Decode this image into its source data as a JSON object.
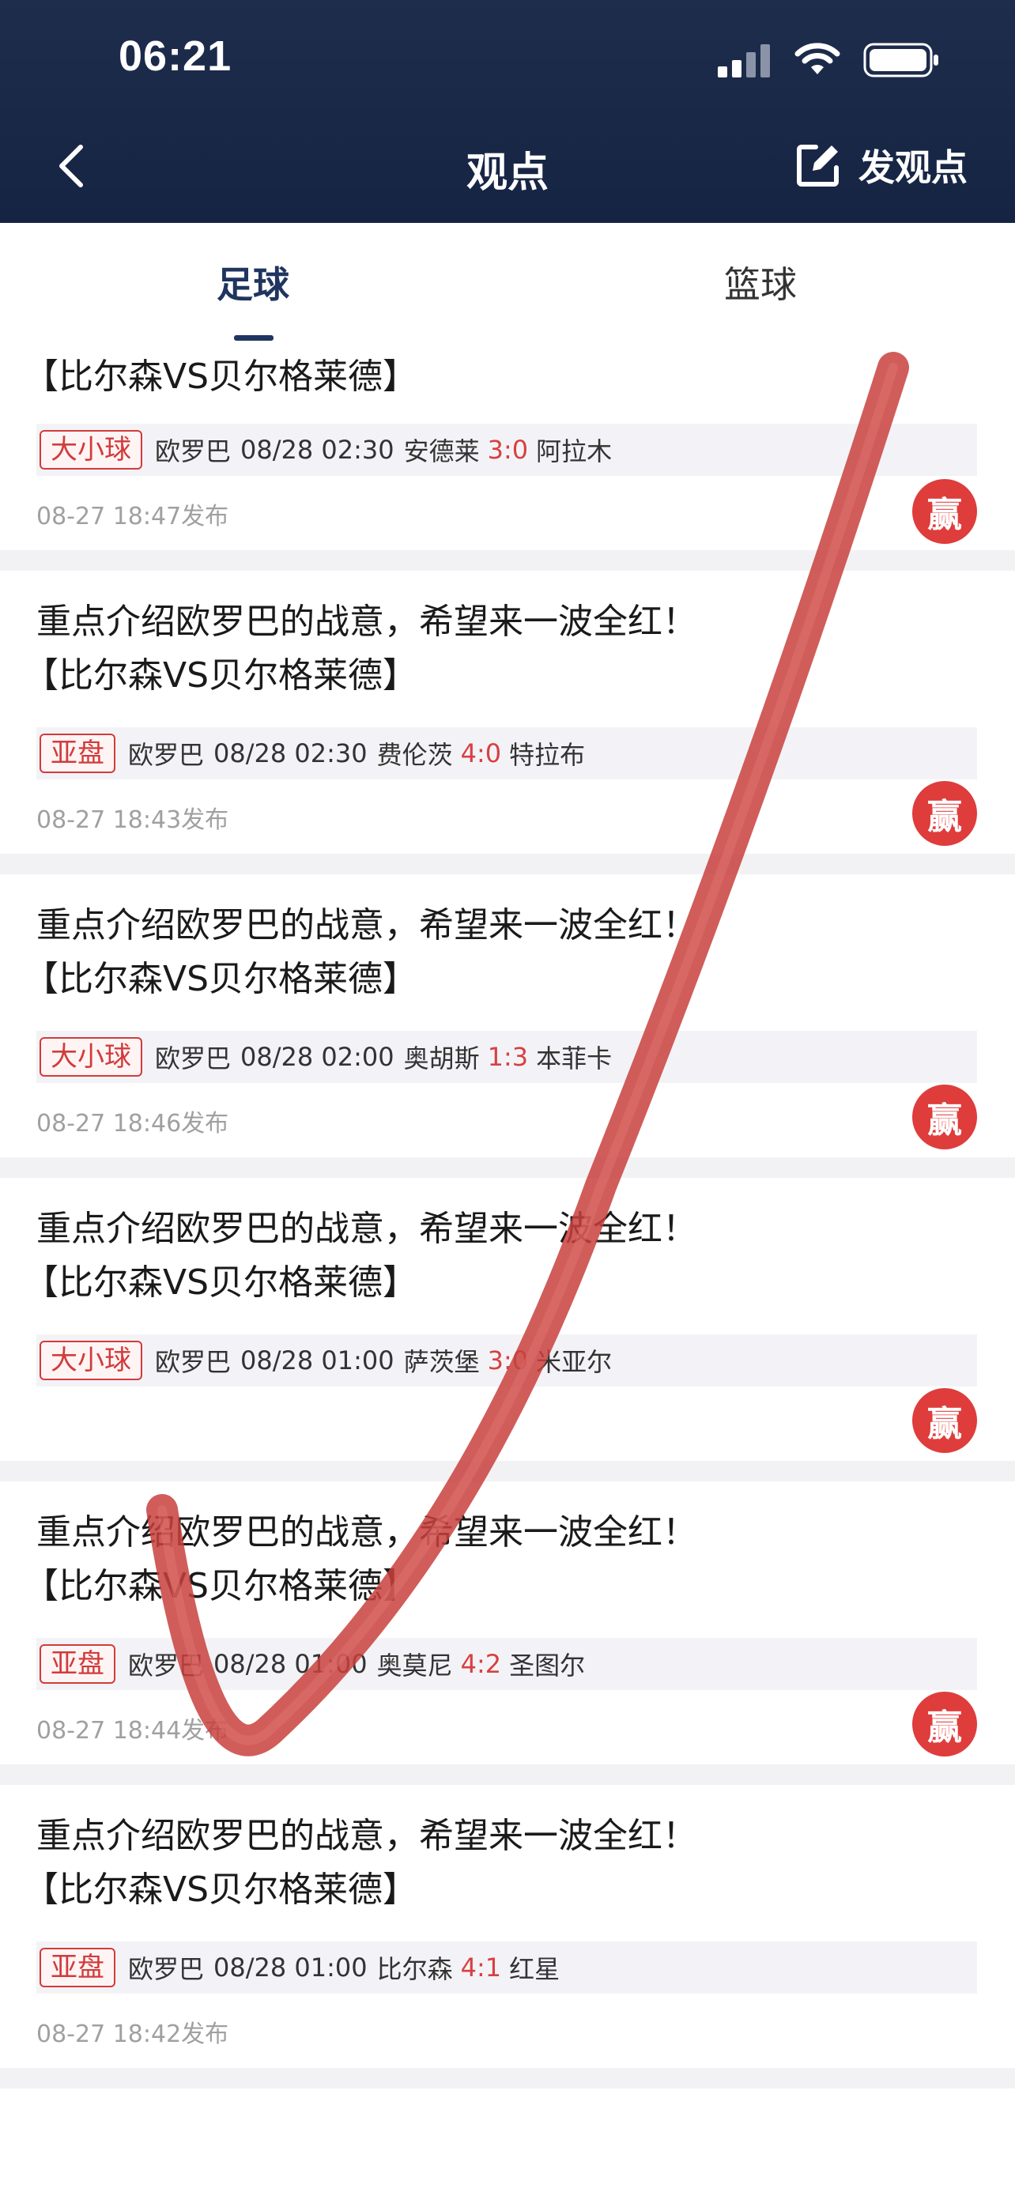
{
  "status": {
    "time": "06:21"
  },
  "header": {
    "title": "观点",
    "publish_label": "发观点"
  },
  "tabs": [
    {
      "label": "足球"
    },
    {
      "label": "篮球"
    }
  ],
  "posts": [
    {
      "title1": "",
      "title2": "【比尔森VS贝尔格莱德】",
      "tag": "大小球",
      "league": "欧罗巴",
      "datetime": "08/28 02:30",
      "home": "安德莱",
      "score": "3:0",
      "away": "阿拉木",
      "posted": "08-27 18:47发布",
      "result": "赢"
    },
    {
      "title1": "重点介绍欧罗巴的战意，希望来一波全红！",
      "title2": "【比尔森VS贝尔格莱德】",
      "tag": "亚盘",
      "league": "欧罗巴",
      "datetime": "08/28 02:30",
      "home": "费伦茨",
      "score": "4:0",
      "away": "特拉布",
      "posted": "08-27 18:43发布",
      "result": "赢"
    },
    {
      "title1": "重点介绍欧罗巴的战意，希望来一波全红！",
      "title2": "【比尔森VS贝尔格莱德】",
      "tag": "大小球",
      "league": "欧罗巴",
      "datetime": "08/28 02:00",
      "home": "奥胡斯",
      "score": "1:3",
      "away": "本菲卡",
      "posted": "08-27 18:46发布",
      "result": "赢"
    },
    {
      "title1": "重点介绍欧罗巴的战意，希望来一波全红！",
      "title2": "【比尔森VS贝尔格莱德】",
      "tag": "大小球",
      "league": "欧罗巴",
      "datetime": "08/28 01:00",
      "home": "萨茨堡",
      "score": "3:0",
      "away": "米亚尔",
      "posted": "",
      "result": "赢"
    },
    {
      "title1": "重点介绍欧罗巴的战意，希望来一波全红！",
      "title2": "【比尔森VS贝尔格莱德】",
      "tag": "亚盘",
      "league": "欧罗巴",
      "datetime": "08/28 01:00",
      "home": "奥莫尼",
      "score": "4:2",
      "away": "圣图尔",
      "posted": "08-27 18:44发布",
      "result": "赢"
    },
    {
      "title1": "重点介绍欧罗巴的战意，希望来一波全红！",
      "title2": "【比尔森VS贝尔格莱德】",
      "tag": "亚盘",
      "league": "欧罗巴",
      "datetime": "08/28 01:00",
      "home": "比尔森",
      "score": "4:1",
      "away": "红星",
      "posted": "08-27 18:42发布",
      "result": ""
    }
  ],
  "colors": {
    "header_bg": "#1f2d4d",
    "accent": "#1f3560",
    "win": "#df3c3c",
    "check_stroke": "#c8413d"
  },
  "icons": {
    "back": "chevron-left-icon",
    "publish": "edit-icon",
    "signal": "signal-icon",
    "wifi": "wifi-icon",
    "battery": "battery-icon"
  }
}
